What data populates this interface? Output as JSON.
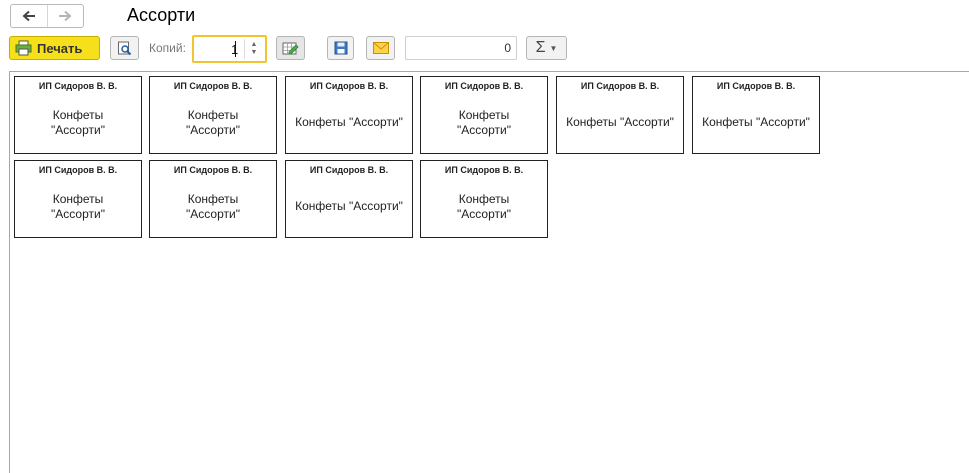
{
  "window": {
    "title": "Ассорти"
  },
  "toolbar": {
    "print_label": "Печать",
    "copies_label": "Копий:",
    "copies_value": "1",
    "sum_value": "0",
    "sigma_symbol": "Σ"
  },
  "labels": [
    {
      "seller": "ИП Сидоров В. В.",
      "product": "Конфеты \"Ассорти\""
    },
    {
      "seller": "ИП Сидоров В. В.",
      "product": "Конфеты \"Ассорти\""
    },
    {
      "seller": "ИП Сидоров В. В.",
      "product": "Конфеты \"Ассорти\""
    },
    {
      "seller": "ИП Сидоров В. В.",
      "product": "Конфеты \"Ассорти\""
    },
    {
      "seller": "ИП Сидоров В. В.",
      "product": "Конфеты \"Ассорти\""
    },
    {
      "seller": "ИП Сидоров В. В.",
      "product": "Конфеты \"Ассорти\""
    },
    {
      "seller": "ИП Сидоров В. В.",
      "product": "Конфеты \"Ассорти\""
    },
    {
      "seller": "ИП Сидоров В. В.",
      "product": "Конфеты \"Ассорти\""
    },
    {
      "seller": "ИП Сидоров В. В.",
      "product": "Конфеты \"Ассорти\""
    },
    {
      "seller": "ИП Сидоров В. В.",
      "product": "Конфеты \"Ассорти\""
    }
  ],
  "icons": {
    "back": "arrow-left-icon",
    "forward": "arrow-right-icon",
    "print": "printer-icon",
    "preview": "preview-magnifier-icon",
    "edit": "edit-table-icon",
    "save": "floppy-disk-icon",
    "mail": "envelope-icon",
    "sum": "sigma-icon"
  },
  "colors": {
    "print_button": "#f5e01b",
    "copies_focus": "#f4c430"
  }
}
